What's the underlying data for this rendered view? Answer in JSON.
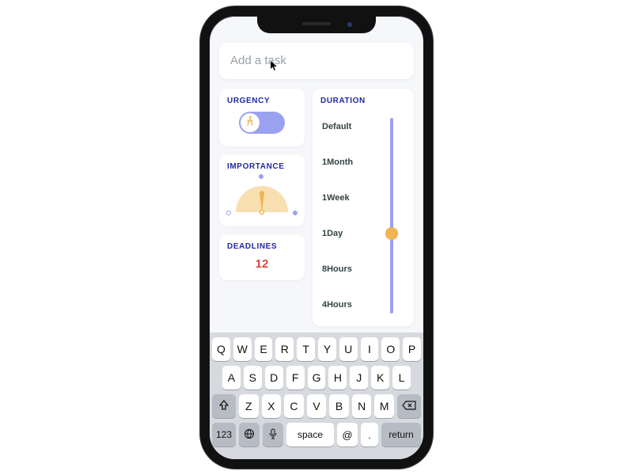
{
  "input": {
    "placeholder": "Add a task",
    "value": ""
  },
  "urgency": {
    "title": "URGENCY",
    "on": false
  },
  "importance": {
    "title": "IMPORTANCE"
  },
  "deadlines": {
    "title": "DEADLINES",
    "value": "12"
  },
  "duration": {
    "title": "DURATION",
    "options": [
      "Default",
      "1Month",
      "1Week",
      "1Day",
      "8Hours",
      "4Hours"
    ],
    "selected_index": 3
  },
  "keyboard": {
    "row1": [
      "Q",
      "W",
      "E",
      "R",
      "T",
      "Y",
      "U",
      "I",
      "O",
      "P"
    ],
    "row2": [
      "A",
      "S",
      "D",
      "F",
      "G",
      "H",
      "J",
      "K",
      "L"
    ],
    "row3": [
      "Z",
      "X",
      "C",
      "V",
      "B",
      "N",
      "M"
    ],
    "numeric": "123",
    "space": "space",
    "at": "@",
    "period": ".",
    "return": "return"
  },
  "colors": {
    "accent": "#9aa1ef",
    "title": "#1f2aa0",
    "warn": "#d84b3f",
    "thumb": "#f0b455",
    "gauge_fill": "#f7dfb0"
  }
}
